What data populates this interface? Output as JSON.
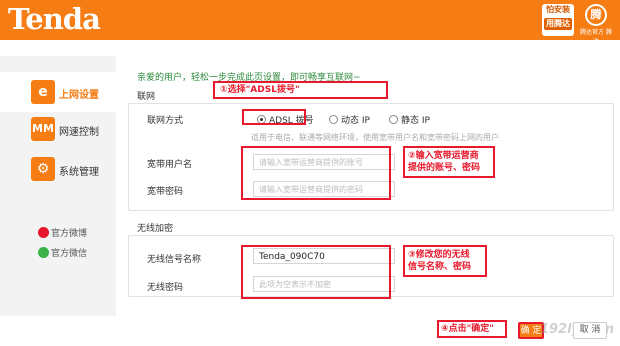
{
  "header": {
    "logo": "Tenda",
    "badge_top": "怕安装",
    "badge_bottom": "用腾达",
    "badge2_mark": "腾",
    "badge2_text": "腾达官方 腾达"
  },
  "sidebar": {
    "items": [
      {
        "label": "上网设置",
        "icon": "internet-e-icon"
      },
      {
        "label": "网速控制",
        "icon": "speed-control-icon"
      },
      {
        "label": "系统管理",
        "icon": "system-gear-icon"
      }
    ],
    "social": [
      {
        "label": "官方微博",
        "icon": "weibo-icon"
      },
      {
        "label": "官方微信",
        "icon": "wechat-icon"
      }
    ]
  },
  "main": {
    "welcome": "亲爱的用户，轻松一步完成此页设置，即可畅享互联网~",
    "internet_section": "联网",
    "connection_label": "联网方式",
    "options": [
      "ADSL 拨号",
      "动态 IP",
      "静态 IP"
    ],
    "selected_option": "ADSL 拨号",
    "hint": "适用于电信、联通等网络环境，使用宽带用户名和宽带密码上网的用户",
    "username_label": "宽带用户名",
    "username_placeholder": "请输入宽带运营商提供的账号",
    "password_label": "宽带密码",
    "password_placeholder": "请输入宽带运营商提供的密码",
    "wireless_section": "无线加密",
    "ssid_label": "无线信号名称",
    "ssid_value": "Tenda_090C70",
    "wifi_pwd_label": "无线密码",
    "wifi_pwd_placeholder": "此项为空表示不加密"
  },
  "annotations": {
    "a1": "①选择\"ADSL拨号\"",
    "a2_line1": "②输入宽带运营商",
    "a2_line2": "提供的账号、密码",
    "a3_line1": "③修改您的无线",
    "a3_line2": "信号名称、密码",
    "a4": "④点击\"确定\""
  },
  "buttons": {
    "ok": "确 定",
    "cancel": "取 消"
  },
  "watermark": "192ly.com",
  "colors": {
    "brand": "#f57d14",
    "annotation": "#e8192c",
    "welcome": "#2e8b3d"
  }
}
